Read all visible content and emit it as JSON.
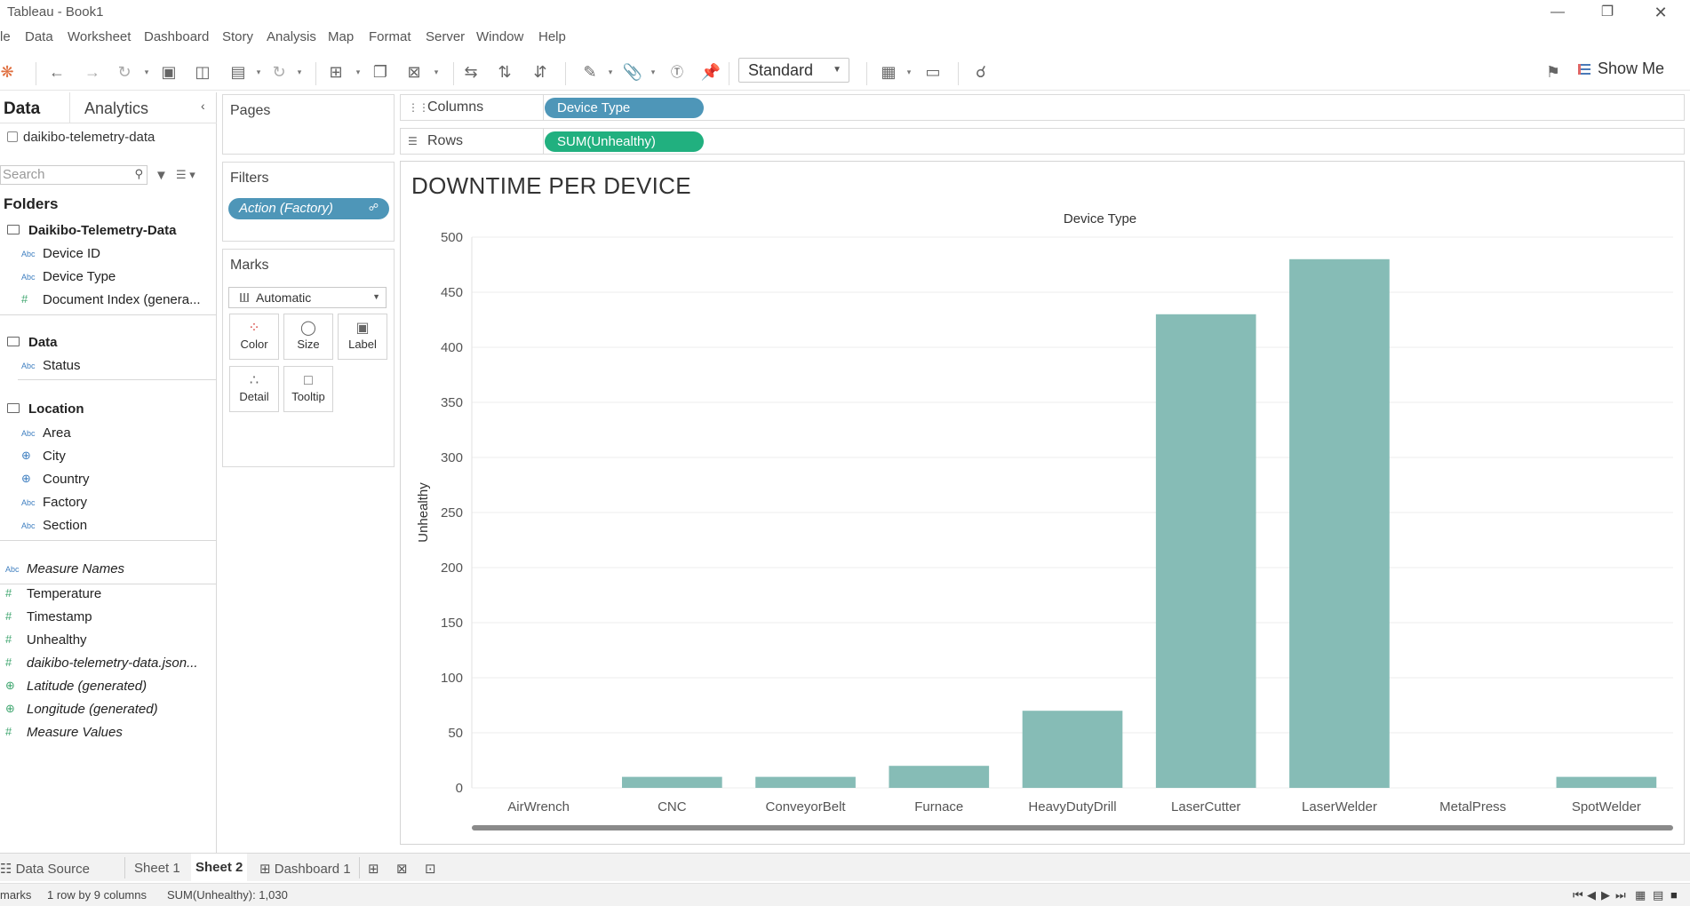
{
  "window": {
    "title": "Tableau - Book1",
    "controls": [
      "minimize-icon",
      "restore-icon",
      "close-icon"
    ]
  },
  "menu": [
    "le",
    "Data",
    "Worksheet",
    "Dashboard",
    "Story",
    "Analysis",
    "Map",
    "Format",
    "Server",
    "Window",
    "Help"
  ],
  "toolbar": {
    "fit_select": "Standard",
    "show_me": "Show Me"
  },
  "data_pane": {
    "tab_data": "Data",
    "tab_analytics": "Analytics",
    "data_source": "daikibo-telemetry-data",
    "search_placeholder": "Search",
    "folders_heading": "Folders",
    "groups": [
      {
        "name": "Daikibo-Telemetry-Data",
        "fields": [
          {
            "type": "Abc",
            "name": "Device ID"
          },
          {
            "type": "Abc",
            "name": "Device Type"
          },
          {
            "type": "#",
            "name": "Document Index (genera..."
          }
        ]
      },
      {
        "name": "Data",
        "fields": [
          {
            "type": "Abc",
            "name": "Status"
          }
        ]
      },
      {
        "name": "Location",
        "fields": [
          {
            "type": "Abc",
            "name": "Area"
          },
          {
            "type": "geo",
            "name": "City"
          },
          {
            "type": "geo",
            "name": "Country"
          },
          {
            "type": "Abc",
            "name": "Factory"
          },
          {
            "type": "Abc",
            "name": "Section"
          }
        ]
      }
    ],
    "measure_names": "Measure Names",
    "measures": [
      {
        "type": "#",
        "name": "Temperature"
      },
      {
        "type": "#",
        "name": "Timestamp"
      },
      {
        "type": "#",
        "name": "Unhealthy"
      },
      {
        "type": "#",
        "name": "daikibo-telemetry-data.json..."
      },
      {
        "type": "geo",
        "name": "Latitude (generated)"
      },
      {
        "type": "geo",
        "name": "Longitude (generated)"
      },
      {
        "type": "#",
        "name": "Measure Values"
      }
    ]
  },
  "cards": {
    "pages": "Pages",
    "filters": "Filters",
    "filter_pill": "Action (Factory)",
    "marks": "Marks",
    "mark_type": "Automatic",
    "mark_buttons": [
      "Color",
      "Size",
      "Label",
      "Detail",
      "Tooltip"
    ]
  },
  "shelves": {
    "columns_label": "Columns",
    "columns_pill": "Device Type",
    "rows_label": "Rows",
    "rows_pill": "SUM(Unhealthy)"
  },
  "chart_data": {
    "type": "bar",
    "title": "DOWNTIME PER DEVICE",
    "column_header": "Device Type",
    "ylabel": "Unhealthy",
    "categories": [
      "AirWrench",
      "CNC",
      "ConveyorBelt",
      "Furnace",
      "HeavyDutyDrill",
      "LaserCutter",
      "LaserWelder",
      "MetalPress",
      "SpotWelder"
    ],
    "values": [
      0,
      10,
      10,
      20,
      70,
      430,
      480,
      0,
      10
    ],
    "yticks": [
      0,
      50,
      100,
      150,
      200,
      250,
      300,
      350,
      400,
      450,
      500
    ],
    "ylim": [
      0,
      500
    ],
    "bar_color": "#86bcb6",
    "grid": true
  },
  "sheet_tabs": {
    "data_source": "Data Source",
    "sheets": [
      "Sheet 1",
      "Sheet 2",
      "Dashboard 1"
    ],
    "active": "Sheet 2"
  },
  "status": {
    "marks": "marks",
    "layout": "1 row by 9 columns",
    "sum": "SUM(Unhealthy): 1,030"
  }
}
